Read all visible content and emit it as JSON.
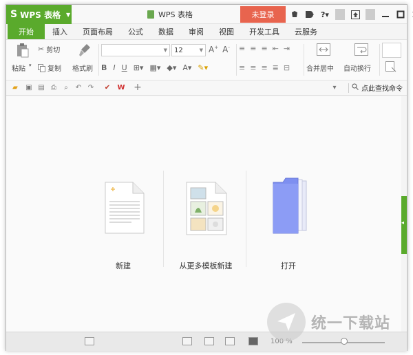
{
  "titlebar": {
    "app_name": "WPS 表格",
    "doc_title": "WPS 表格",
    "login_label": "未登录"
  },
  "tabs": [
    {
      "label": "开始",
      "active": true
    },
    {
      "label": "插入"
    },
    {
      "label": "页面布局"
    },
    {
      "label": "公式"
    },
    {
      "label": "数据"
    },
    {
      "label": "审阅"
    },
    {
      "label": "视图"
    },
    {
      "label": "开发工具"
    },
    {
      "label": "云服务"
    }
  ],
  "ribbon": {
    "paste": "粘贴",
    "cut": "剪切",
    "copy": "复制",
    "format_painter": "格式刷",
    "font_size": "12",
    "merge_center": "合并居中",
    "auto_wrap": "自动换行"
  },
  "quickbar": {
    "find_command": "点此查找命令"
  },
  "start_page": {
    "items": [
      {
        "label": "新建",
        "icon": "new-document-icon"
      },
      {
        "label": "从更多模板新建",
        "icon": "template-document-icon"
      },
      {
        "label": "打开",
        "icon": "open-folder-icon"
      }
    ]
  },
  "statusbar": {
    "zoom": "100 %"
  },
  "watermark": {
    "text": "统一下载站"
  },
  "colors": {
    "accent": "#5aaa2c",
    "login": "#e8644e"
  }
}
